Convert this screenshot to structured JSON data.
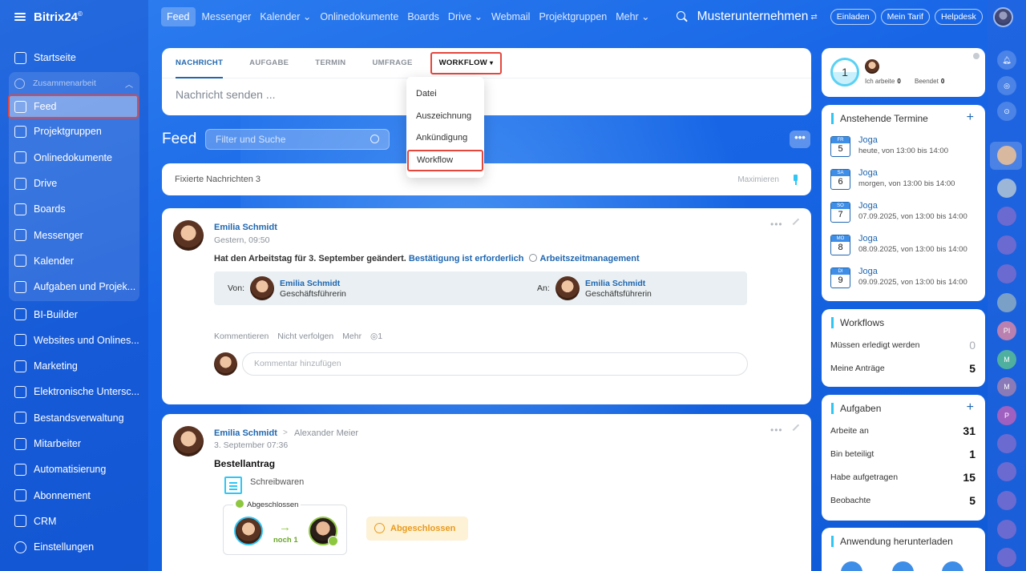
{
  "sidebar": {
    "logo": "Bitrix24",
    "logo_mark": "©",
    "items_top": [
      {
        "label": "Startseite",
        "icon": "home-icon"
      }
    ],
    "group": {
      "label": "Zusammenarbeit",
      "items": [
        {
          "label": "Feed",
          "icon": "feed-icon",
          "active": true
        },
        {
          "label": "Projektgruppen",
          "icon": "groups-icon"
        },
        {
          "label": "Onlinedokumente",
          "icon": "document-icon"
        },
        {
          "label": "Drive",
          "icon": "drive-icon"
        },
        {
          "label": "Boards",
          "icon": "boards-icon"
        },
        {
          "label": "Messenger",
          "icon": "messenger-icon"
        },
        {
          "label": "Kalender",
          "icon": "calendar-icon"
        },
        {
          "label": "Aufgaben und Projek...",
          "icon": "tasks-icon"
        }
      ]
    },
    "items_bottom": [
      {
        "label": "BI-Builder",
        "icon": "bi-icon"
      },
      {
        "label": "Websites und Onlines...",
        "icon": "cart-icon"
      },
      {
        "label": "Marketing",
        "icon": "marketing-icon"
      },
      {
        "label": "Elektronische Untersc...",
        "icon": "signature-icon"
      },
      {
        "label": "Bestandsverwaltung",
        "icon": "inventory-icon"
      },
      {
        "label": "Mitarbeiter",
        "icon": "employees-icon"
      },
      {
        "label": "Automatisierung",
        "icon": "automation-icon"
      },
      {
        "label": "Abonnement",
        "icon": "subscription-icon"
      },
      {
        "label": "CRM",
        "icon": "crm-icon"
      },
      {
        "label": "Einstellungen",
        "icon": "settings-icon"
      }
    ]
  },
  "topbar": {
    "tabs": [
      "Feed",
      "Messenger",
      "Kalender ⌄",
      "Onlinedokumente",
      "Boards",
      "Drive ⌄",
      "Webmail",
      "Projektgruppen",
      "Mehr ⌄"
    ],
    "company": "Musterunternehmen",
    "company_switch": "⇄",
    "buttons": [
      "Einladen",
      "Mein Tarif",
      "Helpdesk"
    ]
  },
  "composer": {
    "tabs": [
      "NACHRICHT",
      "AUFGABE",
      "TERMIN",
      "UMFRAGE"
    ],
    "workflow_tab": "WORKFLOW",
    "workflow_caret": "▾",
    "placeholder": "Nachricht senden ...",
    "dropdown": [
      "Datei",
      "Auszeichnung",
      "Ankündigung",
      "Workflow"
    ]
  },
  "feed": {
    "title": "Feed",
    "filter_placeholder": "Filter und Suche",
    "more": "•••",
    "pinned_label": "Fixierte Nachrichten",
    "pinned_count": "3",
    "maximize": "Maximieren"
  },
  "post1": {
    "author": "Emilia Schmidt",
    "time": "Gestern, 09:50",
    "text": "Hat den Arbeitstag für 3. September geändert.",
    "link": "Bestätigung ist erforderlich",
    "link2": "Arbeitszeitmanagement",
    "from_label": "Von:",
    "to_label": "An:",
    "from_name": "Emilia Schmidt",
    "from_role": "Geschäftsführerin",
    "to_name": "Emilia Schmidt",
    "to_role": "Geschäftsführerin",
    "actions": [
      "Kommentieren",
      "Nicht verfolgen",
      "Mehr"
    ],
    "views": "◎1",
    "comment_placeholder": "Kommentar hinzufügen",
    "menu": "•••"
  },
  "post2": {
    "author": "Emilia Schmidt",
    "recipient": "Alexander Meier",
    "arrow": ">",
    "time": "3. September 07:36",
    "title": "Bestellantrag",
    "doc": "Schreibwaren",
    "status_label": "Abgeschlossen",
    "step_arrow": "→",
    "step_remaining": "noch 1",
    "badge": "Abgeschlossen",
    "menu": "•••"
  },
  "status_widget": {
    "count": "1",
    "working_label": "Ich arbeite",
    "working_value": "0",
    "done_label": "Beendet",
    "done_value": "0"
  },
  "events": {
    "title": "Anstehende Termine",
    "plus": "+",
    "items": [
      {
        "dw": "FR",
        "dn": "5",
        "title": "Joga",
        "time": "heute, von 13:00 bis 14:00"
      },
      {
        "dw": "SA",
        "dn": "6",
        "title": "Joga",
        "time": "morgen, von 13:00 bis 14:00"
      },
      {
        "dw": "SO",
        "dn": "7",
        "title": "Joga",
        "time": "07.09.2025, von 13:00 bis 14:00"
      },
      {
        "dw": "MO",
        "dn": "8",
        "title": "Joga",
        "time": "08.09.2025, von 13:00 bis 14:00"
      },
      {
        "dw": "DI",
        "dn": "9",
        "title": "Joga",
        "time": "09.09.2025, von 13:00 bis 14:00"
      }
    ]
  },
  "workflows": {
    "title": "Workflows",
    "rows": [
      {
        "label": "Müssen erledigt werden",
        "value": "0"
      },
      {
        "label": "Meine Anträge",
        "value": "5"
      }
    ]
  },
  "tasks": {
    "title": "Aufgaben",
    "plus": "+",
    "rows": [
      {
        "label": "Arbeite an",
        "value": "31"
      },
      {
        "label": "Bin beteiligt",
        "value": "1"
      },
      {
        "label": "Habe aufgetragen",
        "value": "15"
      },
      {
        "label": "Beobachte",
        "value": "5"
      }
    ]
  },
  "app": {
    "title": "Anwendung herunterladen"
  },
  "rail": [
    "PI",
    "M",
    "M",
    "P"
  ]
}
